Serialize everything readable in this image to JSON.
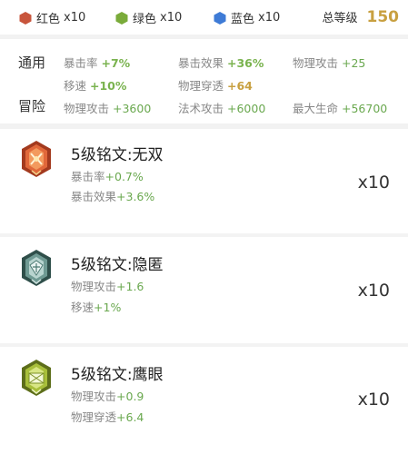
{
  "gems": [
    {
      "name": "红色",
      "count": "x10",
      "color": "#c8553c",
      "icon": "red-gem-icon"
    },
    {
      "name": "绿色",
      "count": "x10",
      "color": "#7aab3a",
      "icon": "green-gem-icon"
    },
    {
      "name": "蓝色",
      "count": "x10",
      "color": "#3e7bd6",
      "icon": "blue-gem-icon"
    }
  ],
  "grade": {
    "label": "总等级",
    "value": "150"
  },
  "summary": {
    "cat1": "通用",
    "cat2": "冒险",
    "stats": [
      {
        "name": "暴击率",
        "value": "+7%"
      },
      {
        "name": "暴击效果",
        "value": "+36%"
      },
      {
        "name": "物理攻击",
        "value": "+25"
      },
      {
        "name": "移速",
        "value": "+10%"
      },
      {
        "name": "物理穿透",
        "value": "+64"
      },
      {
        "name": "物理攻击",
        "value": "+3600"
      },
      {
        "name": "法术攻击",
        "value": "+6000"
      },
      {
        "name": "最大生命",
        "value": "+56700"
      }
    ]
  },
  "inscriptions": [
    {
      "title": "5级铭文:无双",
      "count": "x10",
      "icon": "red-inscription-icon",
      "stats": [
        {
          "name": "暴击率",
          "value": "+0.7%"
        },
        {
          "name": "暴击效果",
          "value": "+3.6%"
        }
      ]
    },
    {
      "title": "5级铭文:隐匿",
      "count": "x10",
      "icon": "blue-inscription-icon",
      "stats": [
        {
          "name": "物理攻击",
          "value": "+1.6"
        },
        {
          "name": "移速",
          "value": "+1%"
        }
      ]
    },
    {
      "title": "5级铭文:鹰眼",
      "count": "x10",
      "icon": "green-inscription-icon",
      "stats": [
        {
          "name": "物理攻击",
          "value": "+0.9"
        },
        {
          "name": "物理穿透",
          "value": "+6.4"
        }
      ]
    }
  ]
}
